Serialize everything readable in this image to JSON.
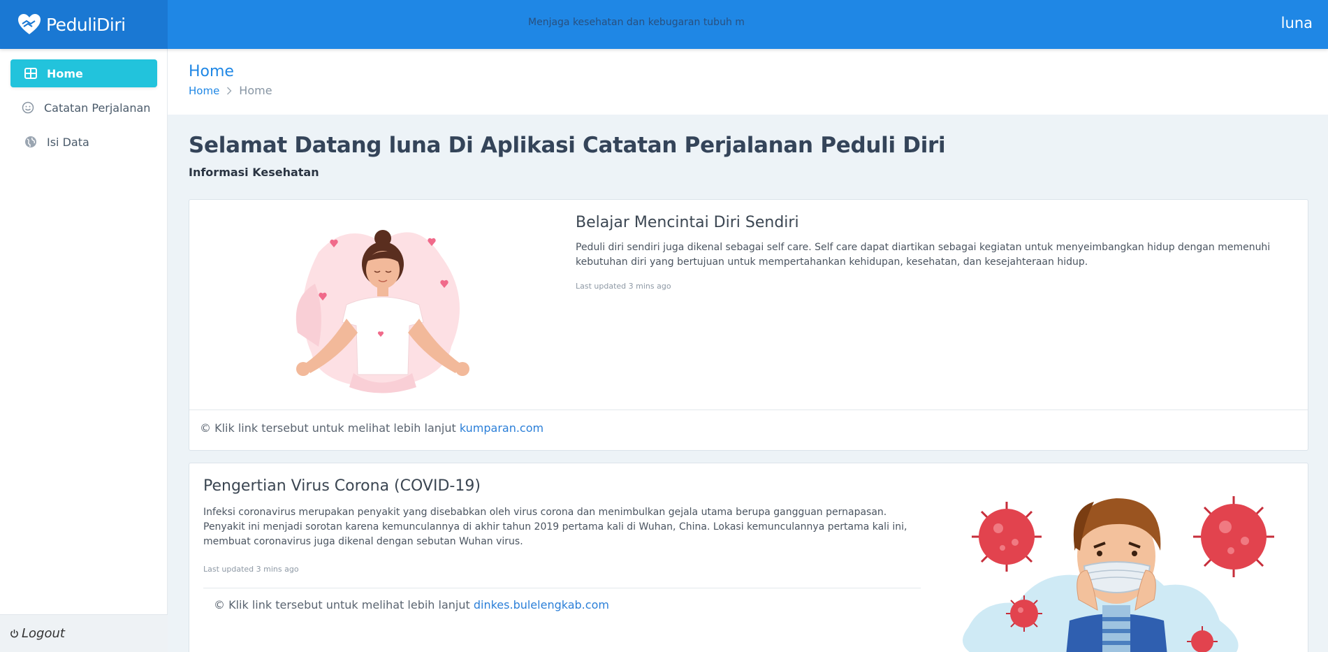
{
  "app": {
    "brand": "PeduliDiri",
    "marquee": "Menjaga kesehatan dan kebugaran tubuh m",
    "user": "luna"
  },
  "sidebar": {
    "items": [
      {
        "label": "Home",
        "icon": "grid-icon",
        "active": true
      },
      {
        "label": "Catatan Perjalanan",
        "icon": "smile-icon",
        "active": false
      },
      {
        "label": "Isi Data",
        "icon": "globe-icon",
        "active": false
      }
    ],
    "logout_label": "Logout"
  },
  "header": {
    "title": "Home",
    "breadcrumb": [
      "Home",
      "Home"
    ]
  },
  "main": {
    "welcome": "Selamat Datang luna Di Aplikasi Catatan Perjalanan Peduli Diri",
    "subtitle": "Informasi Kesehatan",
    "cards": [
      {
        "title": "Belajar Mencintai Diri Sendiri",
        "body": "Peduli diri sendiri juga dikenal sebagai self care. Self care dapat diartikan sebagai kegiatan untuk menyeimbangkan hidup dengan memenuhi kebutuhan diri yang bertujuan untuk mempertahankan kehidupan, kesehatan, dan kesejahteraan hidup.",
        "updated": "Last updated 3 mins ago",
        "footer_text": "© Klik link tersebut untuk melihat lebih lanjut ",
        "link": "kumparan.com"
      },
      {
        "title": "Pengertian Virus Corona (COVID-19)",
        "body": "Infeksi coronavirus merupakan penyakit yang disebabkan oleh virus corona dan menimbulkan gejala utama berupa gangguan pernapasan. Penyakit ini menjadi sorotan karena kemunculannya di akhir tahun 2019 pertama kali di Wuhan, China. Lokasi kemunculannya pertama kali ini, membuat coronavirus juga dikenal dengan sebutan Wuhan virus.",
        "updated": "Last updated 3 mins ago",
        "footer_text": "© Klik link tersebut untuk melihat lebih lanjut ",
        "link": "dinkes.bulelengkab.com"
      }
    ]
  },
  "colors": {
    "primary": "#1f87e5",
    "active_nav": "#22c3dc",
    "heading": "#344459",
    "background": "#edf3f7"
  }
}
